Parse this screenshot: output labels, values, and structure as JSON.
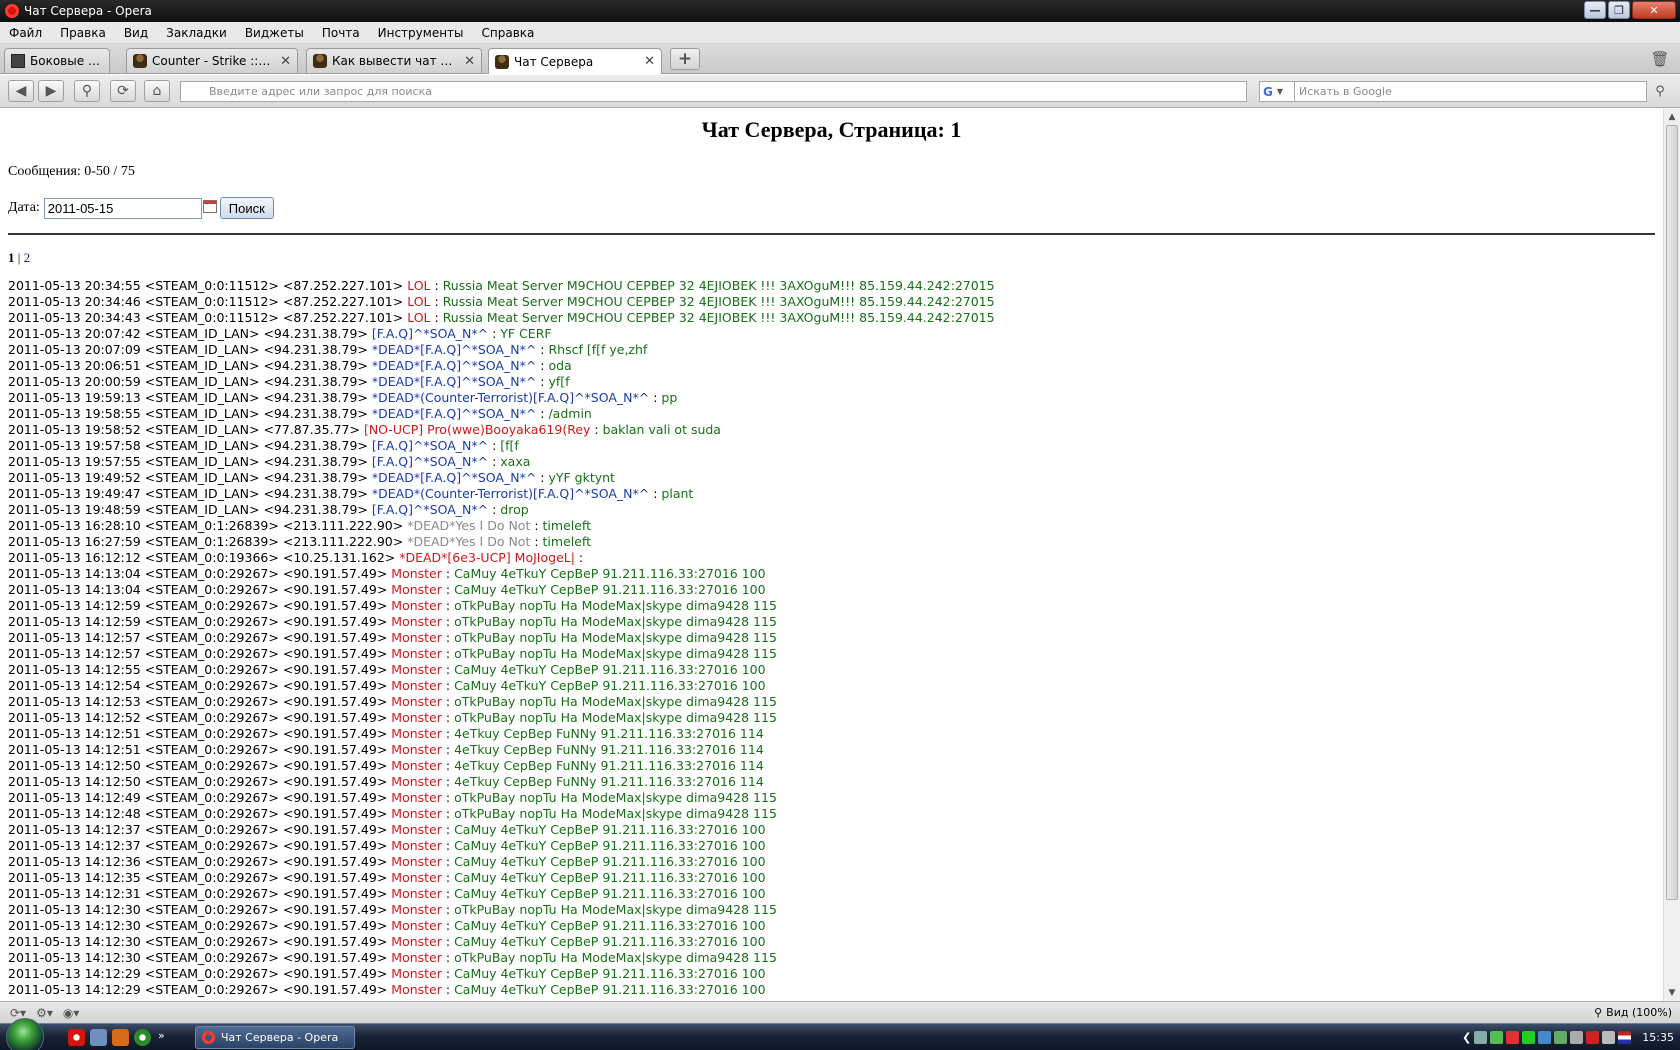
{
  "window": {
    "title": "Чат Сервера - Opera"
  },
  "menu": [
    "Файл",
    "Правка",
    "Вид",
    "Закладки",
    "Виджеты",
    "Почта",
    "Инструменты",
    "Справка"
  ],
  "tabs": [
    {
      "label": "Боковые панели"
    },
    {
      "label": "Counter - Strike :: Supp..."
    },
    {
      "label": "Как вывести чат на са..."
    },
    {
      "label": "Чат Сервера"
    }
  ],
  "address": {
    "placeholder": "Введите адрес или запрос для поиска"
  },
  "search": {
    "placeholder": "Искать в Google",
    "engine": "G"
  },
  "page": {
    "title": "Чат Сервера, Страница: 1",
    "messages_label": "Сообщения: 0-50 / 75",
    "date_label": "Дата:",
    "date_value": "2011-05-15",
    "search_button": "Поиск",
    "pages": {
      "current": "1",
      "separator": "|",
      "next": "2"
    }
  },
  "log": [
    {
      "time": "2011-05-13 20:34:55",
      "id": "<STEAM_0:0:11512>",
      "ip": "<87.252.227.101>",
      "nick": "LOL",
      "nc": "red",
      "msg": "Russia Meat Server M9CHOU CEPBEP 32 4EJIOBEK !!! 3AXOguM!!! 85.159.44.242:27015"
    },
    {
      "time": "2011-05-13 20:34:46",
      "id": "<STEAM_0:0:11512>",
      "ip": "<87.252.227.101>",
      "nick": "LOL",
      "nc": "red",
      "msg": "Russia Meat Server M9CHOU CEPBEP 32 4EJIOBEK !!! 3AXOguM!!! 85.159.44.242:27015"
    },
    {
      "time": "2011-05-13 20:34:43",
      "id": "<STEAM_0:0:11512>",
      "ip": "<87.252.227.101>",
      "nick": "LOL",
      "nc": "red",
      "msg": "Russia Meat Server M9CHOU CEPBEP 32 4EJIOBEK !!! 3AXOguM!!! 85.159.44.242:27015"
    },
    {
      "time": "2011-05-13 20:07:42",
      "id": "<STEAM_ID_LAN>",
      "ip": "<94.231.38.79>",
      "nick": "[F.A.Q]^*SOA_N*^",
      "nc": "blue",
      "msg": "YF CERF"
    },
    {
      "time": "2011-05-13 20:07:09",
      "id": "<STEAM_ID_LAN>",
      "ip": "<94.231.38.79>",
      "nick": "*DEAD*[F.A.Q]^*SOA_N*^",
      "nc": "blue",
      "msg": "Rhscf [f[f ye,zhf"
    },
    {
      "time": "2011-05-13 20:06:51",
      "id": "<STEAM_ID_LAN>",
      "ip": "<94.231.38.79>",
      "nick": "*DEAD*[F.A.Q]^*SOA_N*^",
      "nc": "blue",
      "msg": "oda"
    },
    {
      "time": "2011-05-13 20:00:59",
      "id": "<STEAM_ID_LAN>",
      "ip": "<94.231.38.79>",
      "nick": "*DEAD*[F.A.Q]^*SOA_N*^",
      "nc": "blue",
      "msg": "yf[f"
    },
    {
      "time": "2011-05-13 19:59:13",
      "id": "<STEAM_ID_LAN>",
      "ip": "<94.231.38.79>",
      "nick": "*DEAD*(Counter-Terrorist)[F.A.Q]^*SOA_N*^",
      "nc": "blue",
      "msg": "pp"
    },
    {
      "time": "2011-05-13 19:58:55",
      "id": "<STEAM_ID_LAN>",
      "ip": "<94.231.38.79>",
      "nick": "*DEAD*[F.A.Q]^*SOA_N*^",
      "nc": "blue",
      "msg": "/admin"
    },
    {
      "time": "2011-05-13 19:58:52",
      "id": "<STEAM_ID_LAN>",
      "ip": "<77.87.35.77>",
      "nick": "[NO-UCP] Pro(wwe)Booyaka619(Rey",
      "nc": "red",
      "msg": "baklan vali ot suda"
    },
    {
      "time": "2011-05-13 19:57:58",
      "id": "<STEAM_ID_LAN>",
      "ip": "<94.231.38.79>",
      "nick": "[F.A.Q]^*SOA_N*^",
      "nc": "blue",
      "msg": "[f[f"
    },
    {
      "time": "2011-05-13 19:57:55",
      "id": "<STEAM_ID_LAN>",
      "ip": "<94.231.38.79>",
      "nick": "[F.A.Q]^*SOA_N*^",
      "nc": "blue",
      "msg": "xaxa"
    },
    {
      "time": "2011-05-13 19:49:52",
      "id": "<STEAM_ID_LAN>",
      "ip": "<94.231.38.79>",
      "nick": "*DEAD*[F.A.Q]^*SOA_N*^",
      "nc": "blue",
      "msg": "yYF gktynt"
    },
    {
      "time": "2011-05-13 19:49:47",
      "id": "<STEAM_ID_LAN>",
      "ip": "<94.231.38.79>",
      "nick": "*DEAD*(Counter-Terrorist)[F.A.Q]^*SOA_N*^",
      "nc": "blue",
      "msg": "plant"
    },
    {
      "time": "2011-05-13 19:48:59",
      "id": "<STEAM_ID_LAN>",
      "ip": "<94.231.38.79>",
      "nick": "[F.A.Q]^*SOA_N*^",
      "nc": "blue",
      "msg": "drop"
    },
    {
      "time": "2011-05-13 16:28:10",
      "id": "<STEAM_0:1:26839>",
      "ip": "<213.111.222.90>",
      "nick": "*DEAD*Yes I Do Not",
      "nc": "gray",
      "msg": "timeleft"
    },
    {
      "time": "2011-05-13 16:27:59",
      "id": "<STEAM_0:1:26839>",
      "ip": "<213.111.222.90>",
      "nick": "*DEAD*Yes I Do Not",
      "nc": "gray",
      "msg": "timeleft"
    },
    {
      "time": "2011-05-13 16:12:12",
      "id": "<STEAM_0:0:19366>",
      "ip": "<10.25.131.162>",
      "nick": "*DEAD*[6e3-UCP] MoJIogeL|",
      "nc": "red",
      "msg": ""
    },
    {
      "time": "2011-05-13 14:13:04",
      "id": "<STEAM_0:0:29267>",
      "ip": "<90.191.57.49>",
      "nick": "Monster",
      "nc": "red",
      "msg": "CaMuy 4eTkuY CepBeP 91.211.116.33:27016 100"
    },
    {
      "time": "2011-05-13 14:13:04",
      "id": "<STEAM_0:0:29267>",
      "ip": "<90.191.57.49>",
      "nick": "Monster",
      "nc": "red",
      "msg": "CaMuy 4eTkuY CepBeP 91.211.116.33:27016 100"
    },
    {
      "time": "2011-05-13 14:12:59",
      "id": "<STEAM_0:0:29267>",
      "ip": "<90.191.57.49>",
      "nick": "Monster",
      "nc": "red",
      "msg": "oTkPuBay nopTu Ha ModeMax|skype dima9428 115"
    },
    {
      "time": "2011-05-13 14:12:59",
      "id": "<STEAM_0:0:29267>",
      "ip": "<90.191.57.49>",
      "nick": "Monster",
      "nc": "red",
      "msg": "oTkPuBay nopTu Ha ModeMax|skype dima9428 115"
    },
    {
      "time": "2011-05-13 14:12:57",
      "id": "<STEAM_0:0:29267>",
      "ip": "<90.191.57.49>",
      "nick": "Monster",
      "nc": "red",
      "msg": "oTkPuBay nopTu Ha ModeMax|skype dima9428 115"
    },
    {
      "time": "2011-05-13 14:12:57",
      "id": "<STEAM_0:0:29267>",
      "ip": "<90.191.57.49>",
      "nick": "Monster",
      "nc": "red",
      "msg": "oTkPuBay nopTu Ha ModeMax|skype dima9428 115"
    },
    {
      "time": "2011-05-13 14:12:55",
      "id": "<STEAM_0:0:29267>",
      "ip": "<90.191.57.49>",
      "nick": "Monster",
      "nc": "red",
      "msg": "CaMuy 4eTkuY CepBeP 91.211.116.33:27016 100"
    },
    {
      "time": "2011-05-13 14:12:54",
      "id": "<STEAM_0:0:29267>",
      "ip": "<90.191.57.49>",
      "nick": "Monster",
      "nc": "red",
      "msg": "CaMuy 4eTkuY CepBeP 91.211.116.33:27016 100"
    },
    {
      "time": "2011-05-13 14:12:53",
      "id": "<STEAM_0:0:29267>",
      "ip": "<90.191.57.49>",
      "nick": "Monster",
      "nc": "red",
      "msg": "oTkPuBay nopTu Ha ModeMax|skype dima9428 115"
    },
    {
      "time": "2011-05-13 14:12:52",
      "id": "<STEAM_0:0:29267>",
      "ip": "<90.191.57.49>",
      "nick": "Monster",
      "nc": "red",
      "msg": "oTkPuBay nopTu Ha ModeMax|skype dima9428 115"
    },
    {
      "time": "2011-05-13 14:12:51",
      "id": "<STEAM_0:0:29267>",
      "ip": "<90.191.57.49>",
      "nick": "Monster",
      "nc": "red",
      "msg": "4eTkuy CepBep FuNNy 91.211.116.33:27016 114"
    },
    {
      "time": "2011-05-13 14:12:51",
      "id": "<STEAM_0:0:29267>",
      "ip": "<90.191.57.49>",
      "nick": "Monster",
      "nc": "red",
      "msg": "4eTkuy CepBep FuNNy 91.211.116.33:27016 114"
    },
    {
      "time": "2011-05-13 14:12:50",
      "id": "<STEAM_0:0:29267>",
      "ip": "<90.191.57.49>",
      "nick": "Monster",
      "nc": "red",
      "msg": "4eTkuy CepBep FuNNy 91.211.116.33:27016 114"
    },
    {
      "time": "2011-05-13 14:12:50",
      "id": "<STEAM_0:0:29267>",
      "ip": "<90.191.57.49>",
      "nick": "Monster",
      "nc": "red",
      "msg": "4eTkuy CepBep FuNNy 91.211.116.33:27016 114"
    },
    {
      "time": "2011-05-13 14:12:49",
      "id": "<STEAM_0:0:29267>",
      "ip": "<90.191.57.49>",
      "nick": "Monster",
      "nc": "red",
      "msg": "oTkPuBay nopTu Ha ModeMax|skype dima9428 115"
    },
    {
      "time": "2011-05-13 14:12:48",
      "id": "<STEAM_0:0:29267>",
      "ip": "<90.191.57.49>",
      "nick": "Monster",
      "nc": "red",
      "msg": "oTkPuBay nopTu Ha ModeMax|skype dima9428 115"
    },
    {
      "time": "2011-05-13 14:12:37",
      "id": "<STEAM_0:0:29267>",
      "ip": "<90.191.57.49>",
      "nick": "Monster",
      "nc": "red",
      "msg": "CaMuy 4eTkuY CepBeP 91.211.116.33:27016 100"
    },
    {
      "time": "2011-05-13 14:12:37",
      "id": "<STEAM_0:0:29267>",
      "ip": "<90.191.57.49>",
      "nick": "Monster",
      "nc": "red",
      "msg": "CaMuy 4eTkuY CepBeP 91.211.116.33:27016 100"
    },
    {
      "time": "2011-05-13 14:12:36",
      "id": "<STEAM_0:0:29267>",
      "ip": "<90.191.57.49>",
      "nick": "Monster",
      "nc": "red",
      "msg": "CaMuy 4eTkuY CepBeP 91.211.116.33:27016 100"
    },
    {
      "time": "2011-05-13 14:12:35",
      "id": "<STEAM_0:0:29267>",
      "ip": "<90.191.57.49>",
      "nick": "Monster",
      "nc": "red",
      "msg": "CaMuy 4eTkuY CepBeP 91.211.116.33:27016 100"
    },
    {
      "time": "2011-05-13 14:12:31",
      "id": "<STEAM_0:0:29267>",
      "ip": "<90.191.57.49>",
      "nick": "Monster",
      "nc": "red",
      "msg": "CaMuy 4eTkuY CepBeP 91.211.116.33:27016 100"
    },
    {
      "time": "2011-05-13 14:12:30",
      "id": "<STEAM_0:0:29267>",
      "ip": "<90.191.57.49>",
      "nick": "Monster",
      "nc": "red",
      "msg": "oTkPuBay nopTu Ha ModeMax|skype dima9428 115"
    },
    {
      "time": "2011-05-13 14:12:30",
      "id": "<STEAM_0:0:29267>",
      "ip": "<90.191.57.49>",
      "nick": "Monster",
      "nc": "red",
      "msg": "CaMuy 4eTkuY CepBeP 91.211.116.33:27016 100"
    },
    {
      "time": "2011-05-13 14:12:30",
      "id": "<STEAM_0:0:29267>",
      "ip": "<90.191.57.49>",
      "nick": "Monster",
      "nc": "red",
      "msg": "CaMuy 4eTkuY CepBeP 91.211.116.33:27016 100"
    },
    {
      "time": "2011-05-13 14:12:30",
      "id": "<STEAM_0:0:29267>",
      "ip": "<90.191.57.49>",
      "nick": "Monster",
      "nc": "red",
      "msg": "oTkPuBay nopTu Ha ModeMax|skype dima9428 115"
    },
    {
      "time": "2011-05-13 14:12:29",
      "id": "<STEAM_0:0:29267>",
      "ip": "<90.191.57.49>",
      "nick": "Monster",
      "nc": "red",
      "msg": "CaMuy 4eTkuY CepBeP 91.211.116.33:27016 100"
    },
    {
      "time": "2011-05-13 14:12:29",
      "id": "<STEAM_0:0:29267>",
      "ip": "<90.191.57.49>",
      "nick": "Monster",
      "nc": "red",
      "msg": "CaMuy 4eTkuY CepBeP 91.211.116.33:27016 100"
    }
  ],
  "statusbar": {
    "zoom": "Вид (100%)"
  },
  "taskbar": {
    "task_label": "Чат Сервера - Opera",
    "clock": "15:35"
  },
  "colors": {
    "nick_red": "#cc1a1a",
    "nick_blue": "#1a3ba8",
    "nick_gray": "#8a8a8a",
    "message_green": "#1a6e1a"
  }
}
